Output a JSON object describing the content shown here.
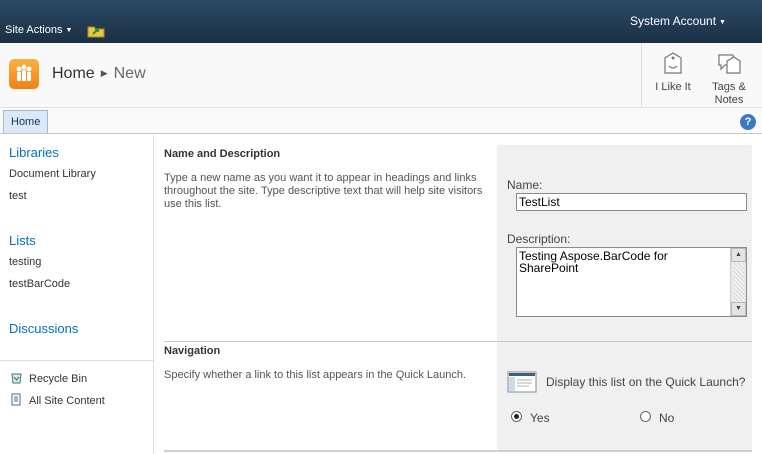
{
  "topbar": {
    "site_actions_label": "Site Actions",
    "account_label": "System Account"
  },
  "breadcrumb": {
    "home": "Home",
    "current": "New"
  },
  "toolbar": {
    "like_label": "I Like It",
    "tags_label_line1": "Tags &",
    "tags_label_line2": "Notes"
  },
  "tabs": {
    "home": "Home",
    "help_glyph": "?"
  },
  "quicklaunch": {
    "libraries_heading": "Libraries",
    "libraries": [
      "Document Library",
      "test"
    ],
    "lists_heading": "Lists",
    "lists": [
      "testing",
      "testBarCode"
    ],
    "discussions_heading": "Discussions",
    "recycle_bin": "Recycle Bin",
    "all_site_content": "All Site Content"
  },
  "form": {
    "name_section": {
      "heading": "Name and Description",
      "description": "Type a new name as you want it to appear in headings and links throughout the site. Type descriptive text that will help site visitors use this list.",
      "name_label": "Name:",
      "name_value": "TestList",
      "description_label": "Description:",
      "description_value": "Testing Aspose.BarCode for SharePoint"
    },
    "navigation_section": {
      "heading": "Navigation",
      "description": "Specify whether a link to this list appears in the Quick Launch.",
      "display_question": "Display this list on the Quick Launch?",
      "yes_label": "Yes",
      "no_label": "No",
      "selected": "Yes"
    }
  },
  "colors": {
    "topbar": "#21374c",
    "link_blue": "#0072bc",
    "panel_gray": "#f0f0f0"
  }
}
